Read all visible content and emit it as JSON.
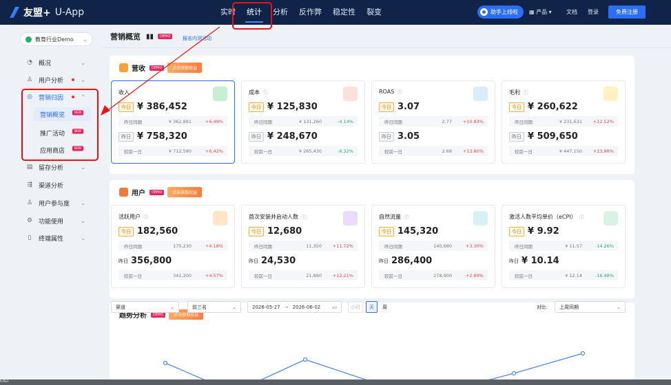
{
  "topbar": {
    "brand": "友盟+",
    "product": "U-App",
    "nav": [
      "实时",
      "统计",
      "分析",
      "反作弊",
      "稳定性",
      "裂变"
    ],
    "active_nav": "统计",
    "helper": "助手上线啦",
    "products": "产品",
    "docs": "文档",
    "login": "登录",
    "signup": "免费注册"
  },
  "sidebar": {
    "app_selector": "教育行业Demo",
    "items": [
      {
        "label": "概况"
      },
      {
        "label": "用户分析"
      },
      {
        "label": "营销归因"
      },
      {
        "label": "留存分析"
      },
      {
        "label": "渠道分析"
      },
      {
        "label": "用户参与度"
      },
      {
        "label": "功能使用"
      },
      {
        "label": "终端属性"
      }
    ],
    "sub_items": [
      {
        "label": "营销概览",
        "badge": "NEW"
      },
      {
        "label": "推广活动",
        "badge": "NEW"
      },
      {
        "label": "应用商店",
        "badge": "NEW"
      }
    ]
  },
  "page": {
    "title": "营销概览",
    "demo_badge": "DEMO",
    "link": "报名内测活动"
  },
  "revenue_section": {
    "title": "营收",
    "demo_badge": "DEMO",
    "button": "点击获取权益",
    "cards": [
      {
        "title": "收入",
        "today_tag": "今日",
        "today_value": "¥ 386,452",
        "cmp1_label": "昨日同期",
        "cmp1_value": "¥ 362,891",
        "cmp1_pct": "+6.49%",
        "yest_tag": "昨日",
        "yest_value": "¥ 758,320",
        "cmp2_label": "较前一日",
        "cmp2_value": "¥ 712,580",
        "cmp2_pct": "+6.42%"
      },
      {
        "title": "成本",
        "today_tag": "今日",
        "today_value": "¥ 125,830",
        "cmp1_label": "昨日同期",
        "cmp1_value": "¥ 131,260",
        "cmp1_pct": "-4.14%",
        "yest_tag": "昨日",
        "yest_value": "¥ 248,670",
        "cmp2_label": "较前一日",
        "cmp2_value": "¥ 265,430",
        "cmp2_pct": "-6.32%"
      },
      {
        "title": "ROAS",
        "today_tag": "今日",
        "today_value": "3.07",
        "cmp1_label": "昨日同期",
        "cmp1_value": "2.77",
        "cmp1_pct": "+10.83%",
        "yest_tag": "昨日",
        "yest_value": "3.05",
        "cmp2_label": "较前一日",
        "cmp2_value": "2.68",
        "cmp2_pct": "+13.80%"
      },
      {
        "title": "毛利",
        "today_tag": "今日",
        "today_value": "¥ 260,622",
        "cmp1_label": "昨日同期",
        "cmp1_value": "¥ 231,631",
        "cmp1_pct": "+12.52%",
        "yest_tag": "昨日",
        "yest_value": "¥ 509,650",
        "cmp2_label": "较前一日",
        "cmp2_value": "¥ 447,150",
        "cmp2_pct": "+13.98%"
      }
    ]
  },
  "user_section": {
    "title": "用户",
    "demo_badge": "DEMO",
    "button": "点击获取权益",
    "cards": [
      {
        "title": "活跃用户",
        "today_tag": "今日",
        "today_value": "182,560",
        "cmp1_label": "昨日同期",
        "cmp1_value": "175,230",
        "cmp1_pct": "+4.18%",
        "yest_tag": "昨日",
        "yest_value": "356,800",
        "cmp2_label": "较前一日",
        "cmp2_value": "341,200",
        "cmp2_pct": "+4.57%"
      },
      {
        "title": "首次安装并启动人数",
        "today_tag": "今日",
        "today_value": "12,680",
        "cmp1_label": "昨日同期",
        "cmp1_value": "11,350",
        "cmp1_pct": "+11.72%",
        "yest_tag": "昨日",
        "yest_value": "24,530",
        "cmp2_label": "较前一日",
        "cmp2_value": "21,860",
        "cmp2_pct": "+12.21%"
      },
      {
        "title": "自然流量",
        "today_tag": "今日",
        "today_value": "145,320",
        "cmp1_label": "昨日同期",
        "cmp1_value": "140,680",
        "cmp1_pct": "+3.30%",
        "yest_tag": "昨日",
        "yest_value": "286,400",
        "cmp2_label": "较前一日",
        "cmp2_value": "278,900",
        "cmp2_pct": "+2.69%"
      },
      {
        "title": "激活人数平均单价（eCPI）",
        "today_tag": "今日",
        "today_value": "¥ 9.92",
        "cmp1_label": "昨日同期",
        "cmp1_value": "¥ 11.57",
        "cmp1_pct": "-14.26%",
        "yest_tag": "昨日",
        "yest_value": "¥ 10.14",
        "cmp2_label": "较前一日",
        "cmp2_value": "¥ 12.14",
        "cmp2_pct": "-16.48%"
      }
    ]
  },
  "trend": {
    "title": "趋势分析",
    "demo_badge": "DEMO",
    "button": "点击获取权益",
    "channel_select": "渠道",
    "top_select": "前三名",
    "date_start": "2026-05-27",
    "date_sep": "→",
    "date_end": "2026-06-02",
    "granularity": [
      "小时",
      "天",
      "周"
    ],
    "active_granularity": "天",
    "compare_label": "对比:",
    "compare_select": "上周同期"
  },
  "bottom_label": "EAD",
  "colors": {
    "accent": "#2b6ef6",
    "up": "#f04545",
    "down": "#1fb36b",
    "highlight": "#e11111"
  }
}
